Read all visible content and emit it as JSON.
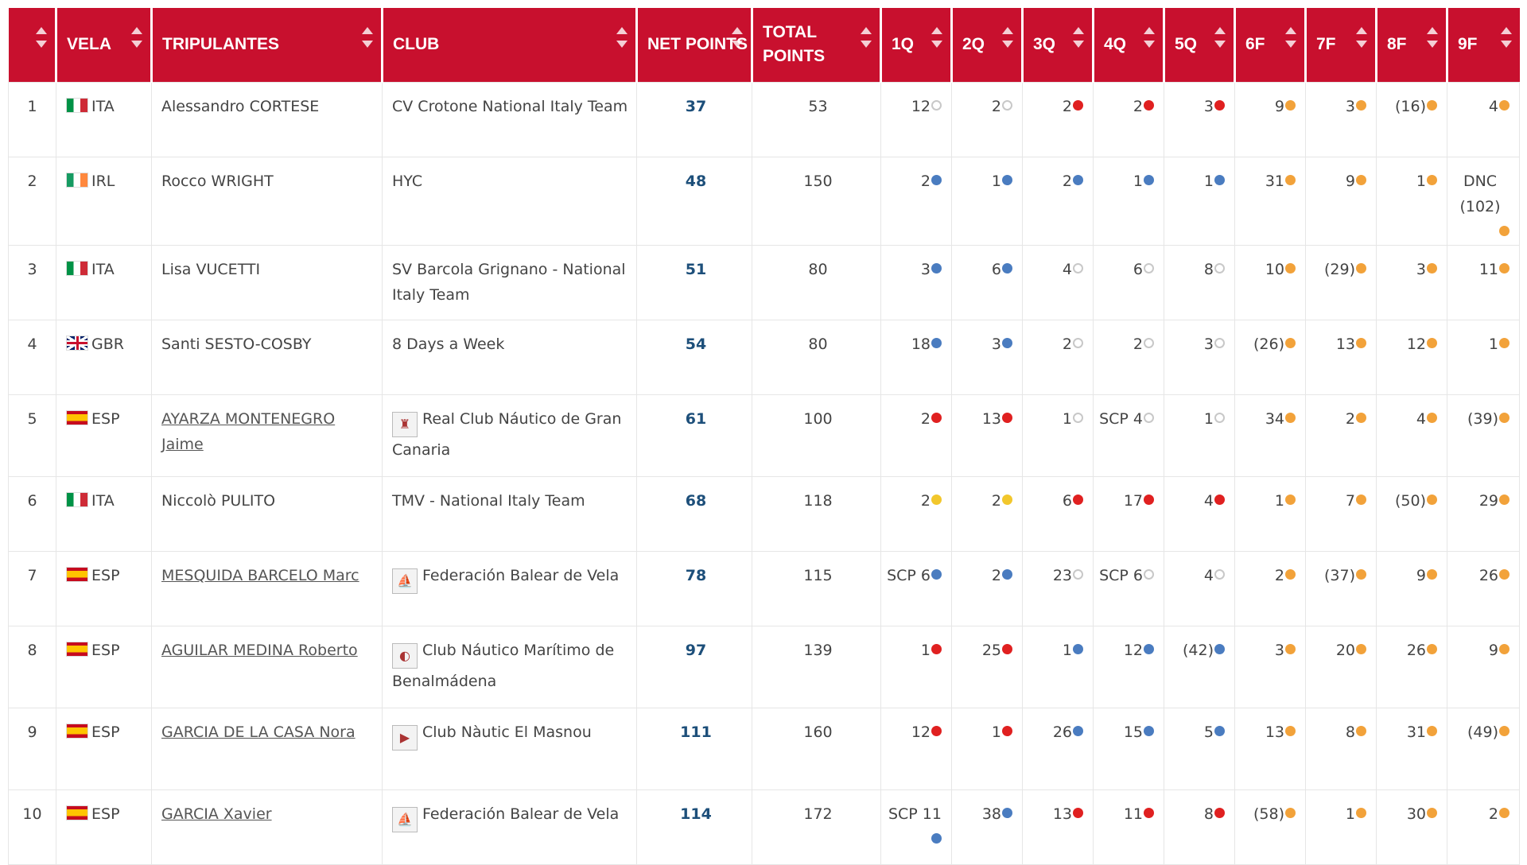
{
  "colors": {
    "header_bg": "#c8102e",
    "net_points_text": "#1d4f7a",
    "dot_red": "#e02020",
    "dot_blue": "#4a7cc0",
    "dot_white": "#ffffff",
    "dot_yellow": "#f2c72c",
    "dot_orange": "#f2a23a"
  },
  "headers": [
    "",
    "VELA",
    "TRIPULANTES",
    "CLUB",
    "NET POINTS",
    "TOTAL POINTS",
    "1Q",
    "2Q",
    "3Q",
    "4Q",
    "5Q",
    "6F",
    "7F",
    "8F",
    "9F"
  ],
  "rows": [
    {
      "rank": "1",
      "country": "ITA",
      "sailor": "Alessandro CORTESE",
      "sailor_link": false,
      "club": "CV Crotone National Italy Team",
      "club_logo": "",
      "net": "37",
      "total": "53",
      "races": [
        [
          "12",
          "white"
        ],
        [
          "2",
          "white"
        ],
        [
          "2",
          "red"
        ],
        [
          "2",
          "red"
        ],
        [
          "3",
          "red"
        ],
        [
          "9",
          "orange"
        ],
        [
          "3",
          "orange"
        ],
        [
          "(16)",
          "orange"
        ],
        [
          "4",
          "orange"
        ]
      ]
    },
    {
      "rank": "2",
      "country": "IRL",
      "sailor": "Rocco WRIGHT",
      "sailor_link": false,
      "club": "HYC",
      "club_logo": "",
      "net": "48",
      "total": "150",
      "races": [
        [
          "2",
          "blue"
        ],
        [
          "1",
          "blue"
        ],
        [
          "2",
          "blue"
        ],
        [
          "1",
          "blue"
        ],
        [
          "1",
          "blue"
        ],
        [
          "31",
          "orange"
        ],
        [
          "9",
          "orange"
        ],
        [
          "1",
          "orange"
        ],
        [
          "DNC (102)",
          "orange"
        ]
      ]
    },
    {
      "rank": "3",
      "country": "ITA",
      "sailor": "Lisa VUCETTI",
      "sailor_link": false,
      "club": "SV Barcola Grignano - National Italy Team",
      "club_logo": "",
      "net": "51",
      "total": "80",
      "races": [
        [
          "3",
          "blue"
        ],
        [
          "6",
          "blue"
        ],
        [
          "4",
          "white"
        ],
        [
          "6",
          "white"
        ],
        [
          "8",
          "white"
        ],
        [
          "10",
          "orange"
        ],
        [
          "(29)",
          "orange"
        ],
        [
          "3",
          "orange"
        ],
        [
          "11",
          "orange"
        ]
      ]
    },
    {
      "rank": "4",
      "country": "GBR",
      "sailor": "Santi SESTO-COSBY",
      "sailor_link": false,
      "club": "8 Days a Week",
      "club_logo": "",
      "net": "54",
      "total": "80",
      "races": [
        [
          "18",
          "blue"
        ],
        [
          "3",
          "blue"
        ],
        [
          "2",
          "white"
        ],
        [
          "2",
          "white"
        ],
        [
          "3",
          "white"
        ],
        [
          "(26)",
          "orange"
        ],
        [
          "13",
          "orange"
        ],
        [
          "12",
          "orange"
        ],
        [
          "1",
          "orange"
        ]
      ]
    },
    {
      "rank": "5",
      "country": "ESP",
      "sailor": "AYARZA MONTENEGRO Jaime",
      "sailor_link": true,
      "club": "Real Club Náutico de Gran Canaria",
      "club_logo": "crest-icon",
      "net": "61",
      "total": "100",
      "races": [
        [
          "2",
          "red"
        ],
        [
          "13",
          "red"
        ],
        [
          "1",
          "white"
        ],
        [
          "SCP 4",
          "white"
        ],
        [
          "1",
          "white"
        ],
        [
          "34",
          "orange"
        ],
        [
          "2",
          "orange"
        ],
        [
          "4",
          "orange"
        ],
        [
          "(39)",
          "orange"
        ]
      ]
    },
    {
      "rank": "6",
      "country": "ITA",
      "sailor": "Niccolò PULITO",
      "sailor_link": false,
      "club": "TMV - National Italy Team",
      "club_logo": "",
      "net": "68",
      "total": "118",
      "races": [
        [
          "2",
          "yellow"
        ],
        [
          "2",
          "yellow"
        ],
        [
          "6",
          "red"
        ],
        [
          "17",
          "red"
        ],
        [
          "4",
          "red"
        ],
        [
          "1",
          "orange"
        ],
        [
          "7",
          "orange"
        ],
        [
          "(50)",
          "orange"
        ],
        [
          "29",
          "orange"
        ]
      ]
    },
    {
      "rank": "7",
      "country": "ESP",
      "sailor": "MESQUIDA BARCELO Marc",
      "sailor_link": true,
      "club": "Federación Balear de Vela",
      "club_logo": "sail-icon",
      "net": "78",
      "total": "115",
      "races": [
        [
          "SCP 6",
          "blue"
        ],
        [
          "2",
          "blue"
        ],
        [
          "23",
          "white"
        ],
        [
          "SCP 6",
          "white"
        ],
        [
          "4",
          "white"
        ],
        [
          "2",
          "orange"
        ],
        [
          "(37)",
          "orange"
        ],
        [
          "9",
          "orange"
        ],
        [
          "26",
          "orange"
        ]
      ]
    },
    {
      "rank": "8",
      "country": "ESP",
      "sailor": "AGUILAR MEDINA Roberto",
      "sailor_link": true,
      "club": "Club Náutico Marítimo de Benalmádena",
      "club_logo": "burgee-icon",
      "net": "97",
      "total": "139",
      "races": [
        [
          "1",
          "red"
        ],
        [
          "25",
          "red"
        ],
        [
          "1",
          "blue"
        ],
        [
          "12",
          "blue"
        ],
        [
          "(42)",
          "blue"
        ],
        [
          "3",
          "orange"
        ],
        [
          "20",
          "orange"
        ],
        [
          "26",
          "orange"
        ],
        [
          "9",
          "orange"
        ]
      ]
    },
    {
      "rank": "9",
      "country": "ESP",
      "sailor": "GARCIA DE LA CASA Nora",
      "sailor_link": true,
      "club": "Club Nàutic El Masnou",
      "club_logo": "pennant-icon",
      "net": "111",
      "total": "160",
      "races": [
        [
          "12",
          "red"
        ],
        [
          "1",
          "red"
        ],
        [
          "26",
          "blue"
        ],
        [
          "15",
          "blue"
        ],
        [
          "5",
          "blue"
        ],
        [
          "13",
          "orange"
        ],
        [
          "8",
          "orange"
        ],
        [
          "31",
          "orange"
        ],
        [
          "(49)",
          "orange"
        ]
      ]
    },
    {
      "rank": "10",
      "country": "ESP",
      "sailor": "GARCIA Xavier",
      "sailor_link": true,
      "club": "Federación Balear de Vela",
      "club_logo": "sail-icon",
      "net": "114",
      "total": "172",
      "races": [
        [
          "SCP 11",
          "blue"
        ],
        [
          "38",
          "blue"
        ],
        [
          "13",
          "red"
        ],
        [
          "11",
          "red"
        ],
        [
          "8",
          "red"
        ],
        [
          "(58)",
          "orange"
        ],
        [
          "1",
          "orange"
        ],
        [
          "30",
          "orange"
        ],
        [
          "2",
          "orange"
        ]
      ]
    }
  ]
}
